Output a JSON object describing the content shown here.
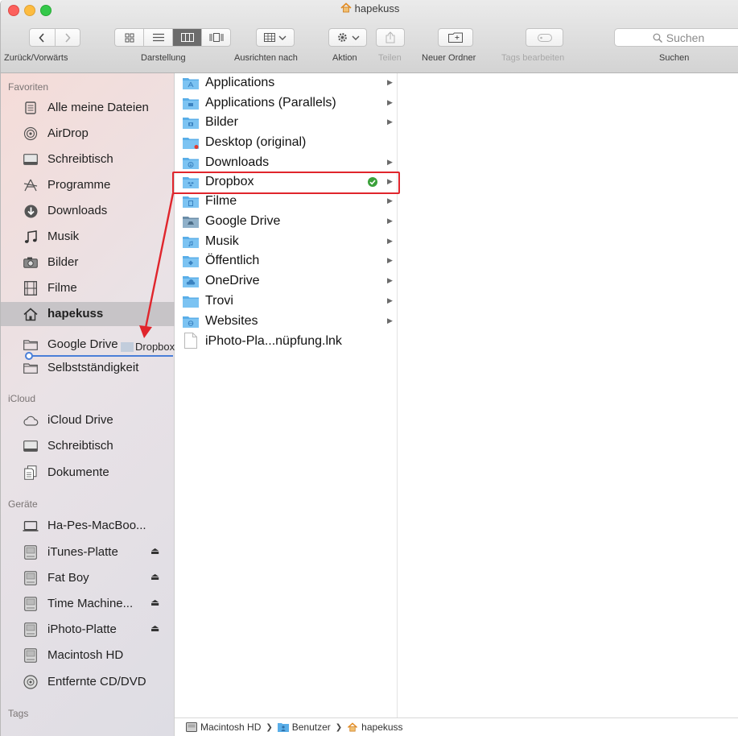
{
  "window": {
    "title": "hapekuss"
  },
  "toolbar": {
    "back_forward_label": "Zurück/Vorwärts",
    "view_label": "Darstellung",
    "arrange_label": "Ausrichten nach",
    "action_label": "Aktion",
    "share_label": "Teilen",
    "new_folder_label": "Neuer Ordner",
    "tags_label": "Tags bearbeiten",
    "search_placeholder": "Suchen",
    "search_label": "Suchen"
  },
  "sidebar": {
    "favorites_heading": "Favoriten",
    "favorites": [
      {
        "label": "Alle meine Dateien",
        "icon": "all-files-icon"
      },
      {
        "label": "AirDrop",
        "icon": "airdrop-icon"
      },
      {
        "label": "Schreibtisch",
        "icon": "desktop-icon"
      },
      {
        "label": "Programme",
        "icon": "applications-icon"
      },
      {
        "label": "Downloads",
        "icon": "downloads-icon"
      },
      {
        "label": "Musik",
        "icon": "music-icon"
      },
      {
        "label": "Bilder",
        "icon": "camera-icon"
      },
      {
        "label": "Filme",
        "icon": "film-icon"
      },
      {
        "label": "hapekuss",
        "icon": "home-icon",
        "selected": true
      },
      {
        "label": "Google Drive",
        "icon": "folder-icon"
      },
      {
        "label": "Selbstständigkeit",
        "icon": "folder-icon"
      }
    ],
    "icloud_heading": "iCloud",
    "icloud": [
      {
        "label": "iCloud Drive",
        "icon": "cloud-icon"
      },
      {
        "label": "Schreibtisch",
        "icon": "desktop-icon"
      },
      {
        "label": "Dokumente",
        "icon": "document-icon"
      }
    ],
    "devices_heading": "Geräte",
    "devices": [
      {
        "label": "Ha-Pes-MacBoo...",
        "icon": "laptop-icon"
      },
      {
        "label": "iTunes-Platte",
        "icon": "disk-icon",
        "eject": "⏏"
      },
      {
        "label": "Fat Boy",
        "icon": "disk-icon",
        "eject": "⏏"
      },
      {
        "label": "Time Machine...",
        "icon": "disk-icon",
        "eject": "⏏"
      },
      {
        "label": "iPhoto-Platte",
        "icon": "disk-icon",
        "eject": "⏏"
      },
      {
        "label": "Macintosh HD",
        "icon": "disk-icon"
      },
      {
        "label": "Entfernte CD/DVD",
        "icon": "cd-icon"
      }
    ],
    "tags_heading": "Tags"
  },
  "files": [
    {
      "name": "Applications",
      "kind": "folder",
      "arrow": "▶"
    },
    {
      "name": "Applications (Parallels)",
      "kind": "folder",
      "arrow": "▶"
    },
    {
      "name": "Bilder",
      "kind": "folder",
      "arrow": "▶"
    },
    {
      "name": "Desktop (original)",
      "kind": "folder-badge",
      "arrow": ""
    },
    {
      "name": "Downloads",
      "kind": "folder",
      "arrow": "▶"
    },
    {
      "name": "Dropbox",
      "kind": "folder",
      "arrow": "▶",
      "synced": true,
      "highlighted": true
    },
    {
      "name": "Filme",
      "kind": "folder",
      "arrow": "▶"
    },
    {
      "name": "Google Drive",
      "kind": "folder",
      "arrow": "▶"
    },
    {
      "name": "Musik",
      "kind": "folder",
      "arrow": "▶"
    },
    {
      "name": "Öffentlich",
      "kind": "folder",
      "arrow": "▶"
    },
    {
      "name": "OneDrive",
      "kind": "folder",
      "arrow": "▶"
    },
    {
      "name": "Trovi",
      "kind": "folder",
      "arrow": "▶"
    },
    {
      "name": "Websites",
      "kind": "folder",
      "arrow": "▶"
    },
    {
      "name": "iPhoto-Pla...nüpfung.lnk",
      "kind": "file",
      "arrow": ""
    }
  ],
  "drag": {
    "label": "Dropbox"
  },
  "pathbar": {
    "segments": [
      "Macintosh HD",
      "Benutzer",
      "hapekuss"
    ],
    "separator": "❯"
  },
  "colors": {
    "highlight": "#e0252c",
    "folder_blue": "#5aaee8",
    "selected_row": "#c7c4c7",
    "sync_green": "#3aa13a"
  }
}
